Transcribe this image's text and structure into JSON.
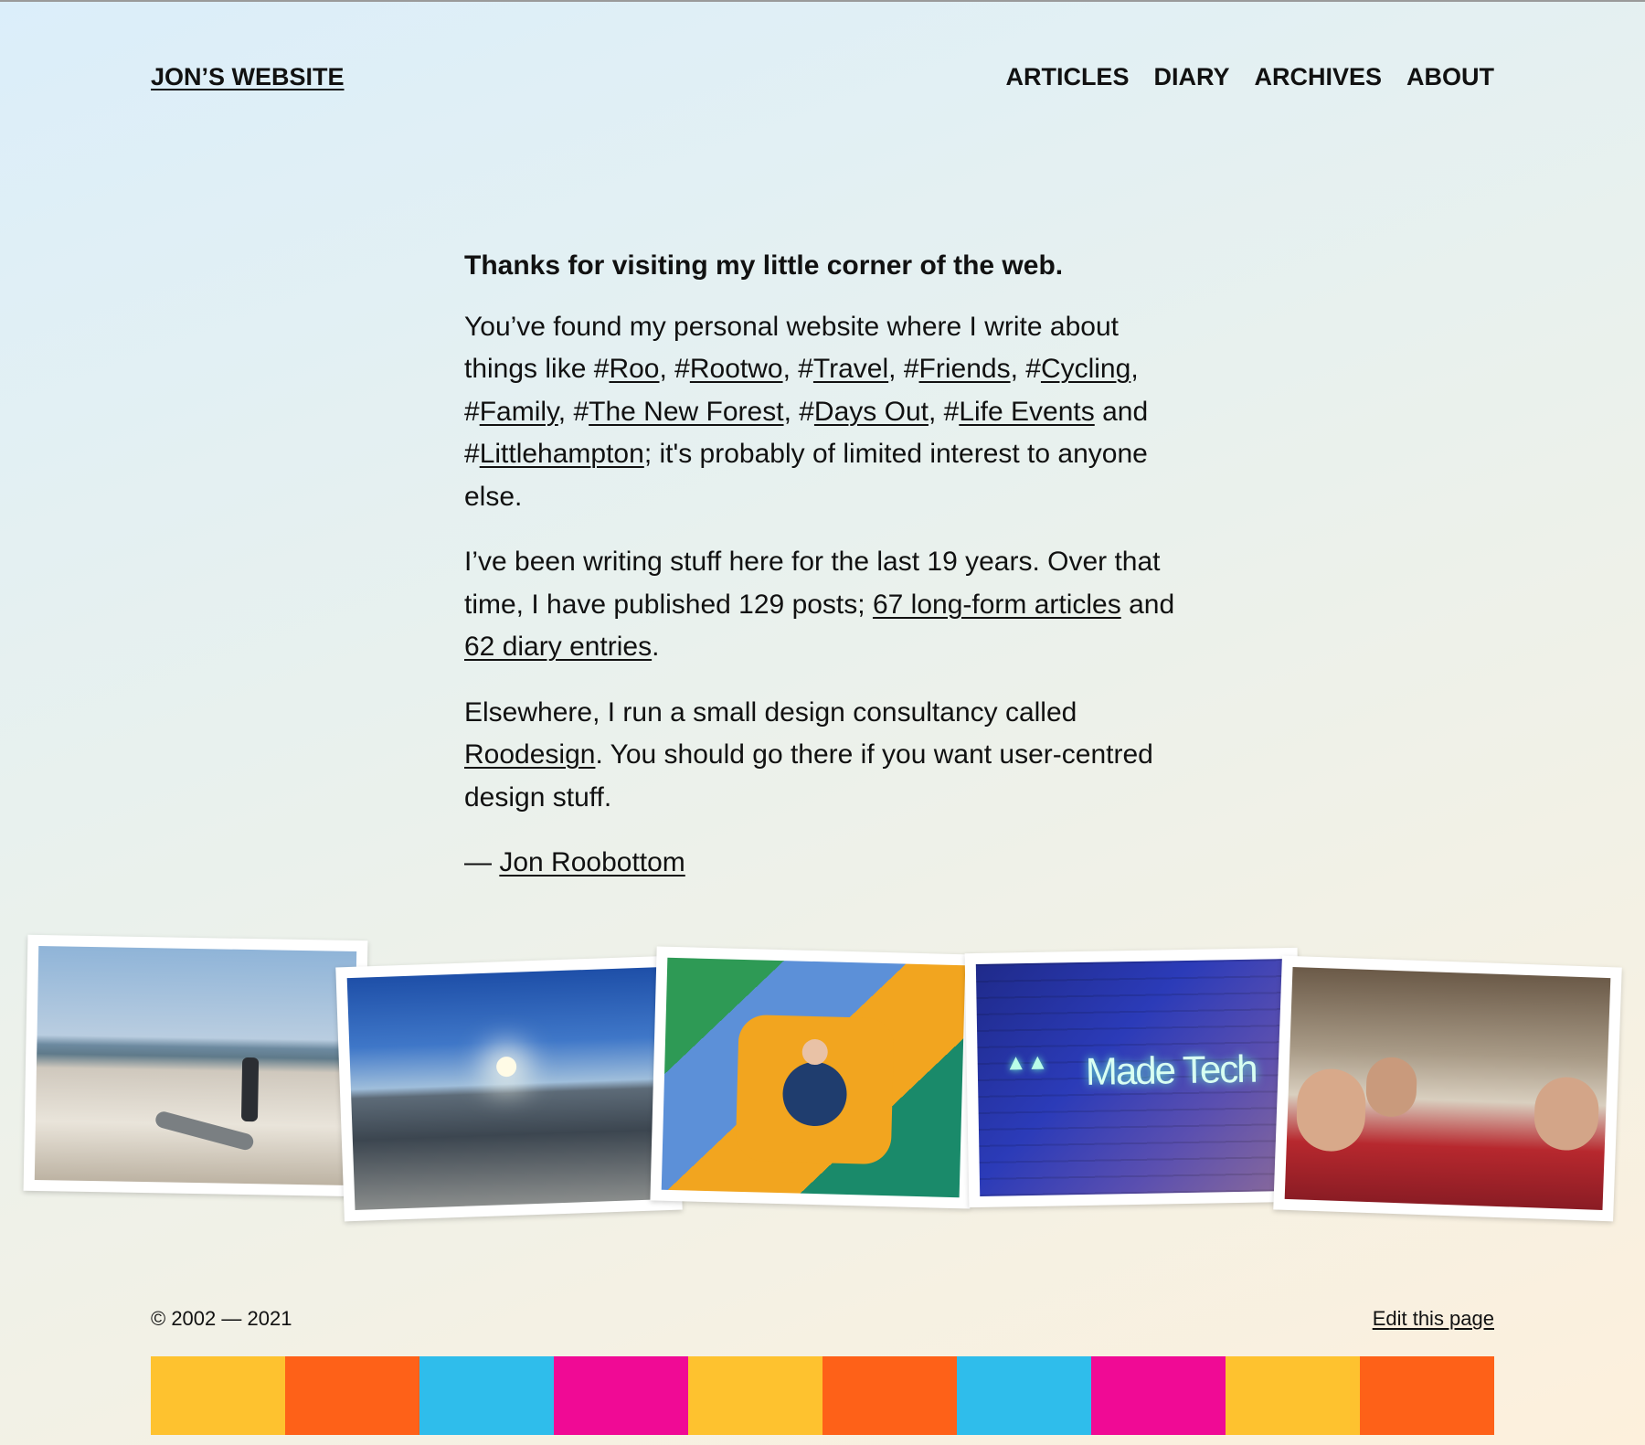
{
  "header": {
    "site_title": "JON’S WEBSITE",
    "nav": [
      "ARTICLES",
      "DIARY",
      "ARCHIVES",
      "ABOUT"
    ]
  },
  "intro": {
    "lead": "Thanks for visiting my little corner of the web.",
    "p1_start": "You’ve found my personal website where I write about things like ",
    "tags": [
      "Roo",
      "Rootwo",
      "Travel",
      "Friends",
      "Cycling",
      "Family",
      "The New Forest",
      "Days Out",
      "Life Events",
      "Littlehampton"
    ],
    "p1_and": " and ",
    "p1_end": "; it's probably of limited interest to anyone else.",
    "p2_start": "I’ve been writing stuff here for the last 19 years. Over that time, I have published 129 posts; ",
    "articles_link": "67 long-form articles",
    "p2_and": " and ",
    "diary_link": "62 diary entries",
    "p2_end": ".",
    "p3_start": "Elsewhere, I run a small design consultancy called ",
    "roodesign_link": "Roodesign",
    "p3_end": ". You should go there if you want user-centred design stuff.",
    "sig_dash": "— ",
    "author_link": "Jon Roobottom"
  },
  "photos": [
    {
      "name": "beach-photo"
    },
    {
      "name": "sunset-sea-photo"
    },
    {
      "name": "soft-play-photo"
    },
    {
      "name": "neon-sign-photo",
      "sign_text": "Made Tech"
    },
    {
      "name": "friends-dinner-photo"
    }
  ],
  "footer": {
    "copyright": "© 2002 — 2021",
    "edit_link": "Edit this page",
    "stripe_colors": [
      "#fec22f",
      "#fe6118",
      "#2fbdeb",
      "#f00a95",
      "#fec22f",
      "#fe6118",
      "#2fbdeb",
      "#f00a95",
      "#fec22f",
      "#fe6118"
    ]
  }
}
